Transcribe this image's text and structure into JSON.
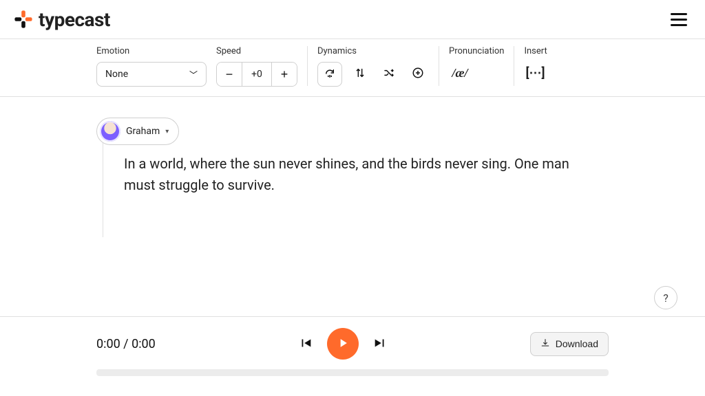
{
  "brand": {
    "name": "typecast"
  },
  "toolbar": {
    "emotion": {
      "label": "Emotion",
      "value": "None"
    },
    "speed": {
      "label": "Speed",
      "value": "+0"
    },
    "dynamics": {
      "label": "Dynamics"
    },
    "pronunciation": {
      "label": "Pronunciation",
      "symbol": "/æ/"
    },
    "insert": {
      "label": "Insert",
      "symbol": "[⋯]"
    }
  },
  "editor": {
    "voice_name": "Graham",
    "script": "In a world, where the sun never shines, and the birds never sing. One man must struggle to survive."
  },
  "player": {
    "current": "0:00",
    "total": "0:00",
    "download_label": "Download"
  },
  "help": {
    "label": "?"
  }
}
